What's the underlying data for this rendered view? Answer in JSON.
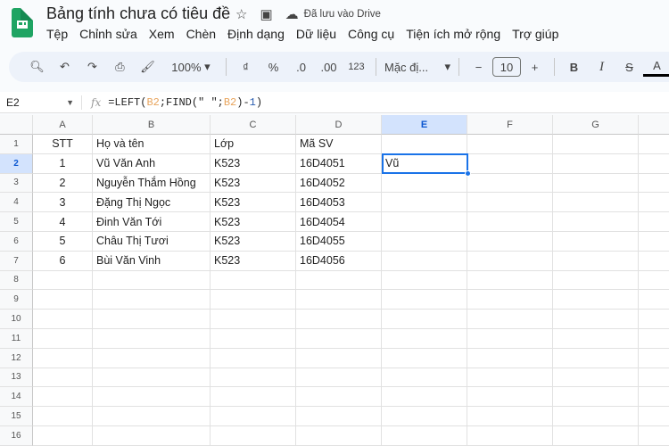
{
  "app": {
    "title": "Bảng tính chưa có tiêu đề",
    "saved_status": "Đã lưu vào Drive"
  },
  "menu": [
    "Tệp",
    "Chỉnh sửa",
    "Xem",
    "Chèn",
    "Định dạng",
    "Dữ liệu",
    "Công cụ",
    "Tiện ích mở rộng",
    "Trợ giúp"
  ],
  "toolbar": {
    "zoom": "100%",
    "currency": "₫",
    "percent": "%",
    "dec_decrease": ".0",
    "dec_increase": ".00",
    "number_format": "123",
    "font": "Mặc đị...",
    "font_size": "10",
    "bold": "B",
    "italic": "I",
    "text_color": "A"
  },
  "formula_bar": {
    "name_box": "E2",
    "fx": "fx",
    "formula_parts": [
      "=LEFT(",
      "B2",
      ";FIND(\" \";",
      "B2",
      ")-",
      "1",
      ")"
    ]
  },
  "columns": [
    "A",
    "B",
    "C",
    "D",
    "E",
    "F",
    "G"
  ],
  "rows": [
    "1",
    "2",
    "3",
    "4",
    "5",
    "6",
    "7",
    "8",
    "9",
    "10",
    "11",
    "12",
    "13",
    "14",
    "15",
    "16"
  ],
  "cells": [
    [
      "STT",
      "Họ và tên",
      "Lớp",
      "Mã SV",
      ""
    ],
    [
      "1",
      "Vũ Văn Anh",
      "K523",
      "16D4051",
      "Vũ"
    ],
    [
      "2",
      "Nguyễn Thắm Hồng",
      "K523",
      "16D4052",
      ""
    ],
    [
      "3",
      "Đặng Thị Ngọc",
      "K523",
      "16D4053",
      ""
    ],
    [
      "4",
      "Đinh Văn Tới",
      "K523",
      "16D4054",
      ""
    ],
    [
      "5",
      "Châu Thị Tươi",
      "K523",
      "16D4055",
      ""
    ],
    [
      "6",
      "Bùi Văn Vinh",
      "K523",
      "16D4056",
      ""
    ]
  ],
  "selected_cell": "E2"
}
